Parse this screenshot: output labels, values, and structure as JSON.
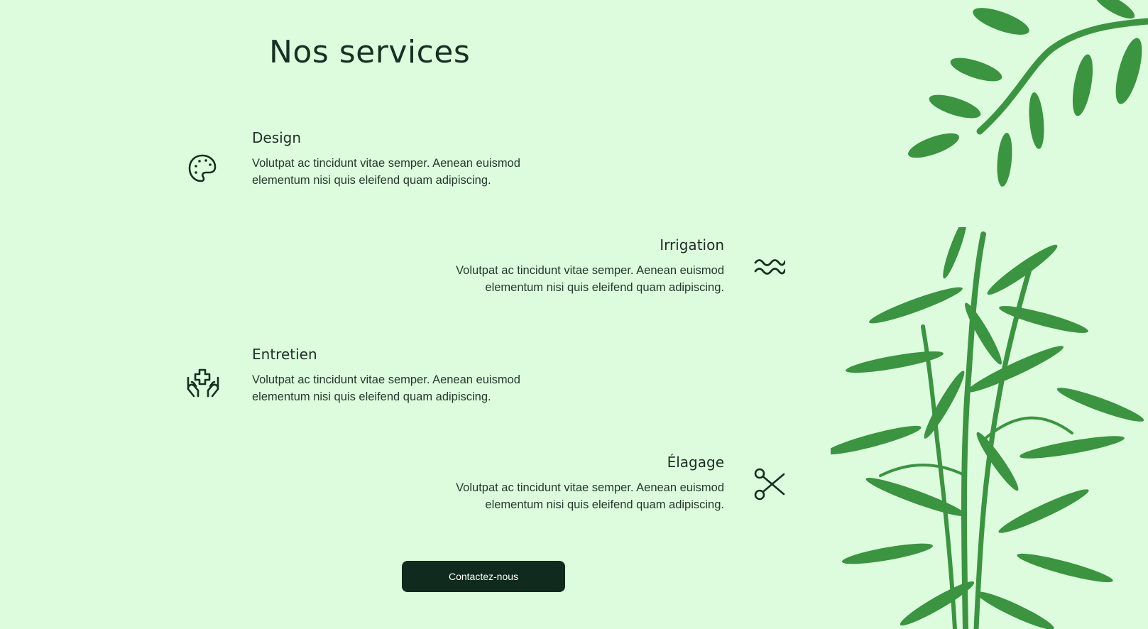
{
  "page": {
    "title": "Nos services",
    "background": "#ddfcdd"
  },
  "services": [
    {
      "title": "Design",
      "description": "Volutpat ac tincidunt vitae semper. Aenean euismod elementum nisi quis eleifend quam adipiscing.",
      "icon": "palette-icon"
    },
    {
      "title": "Irrigation",
      "description": "Volutpat ac tincidunt vitae semper. Aenean euismod elementum nisi quis eleifend quam adipiscing.",
      "icon": "water-waves-icon"
    },
    {
      "title": "Entretien",
      "description": "Volutpat ac tincidunt vitae semper. Aenean euismod elementum nisi quis eleifend quam adipiscing.",
      "icon": "hands-care-icon"
    },
    {
      "title": "Élagage",
      "description": "Volutpat ac tincidunt vitae semper. Aenean euismod elementum nisi quis eleifend quam adipiscing.",
      "icon": "scissors-icon"
    }
  ],
  "cta": {
    "label": "Contactez-nous",
    "background": "#102b1d"
  },
  "decor": {
    "leaf_color": "#3a9440"
  }
}
